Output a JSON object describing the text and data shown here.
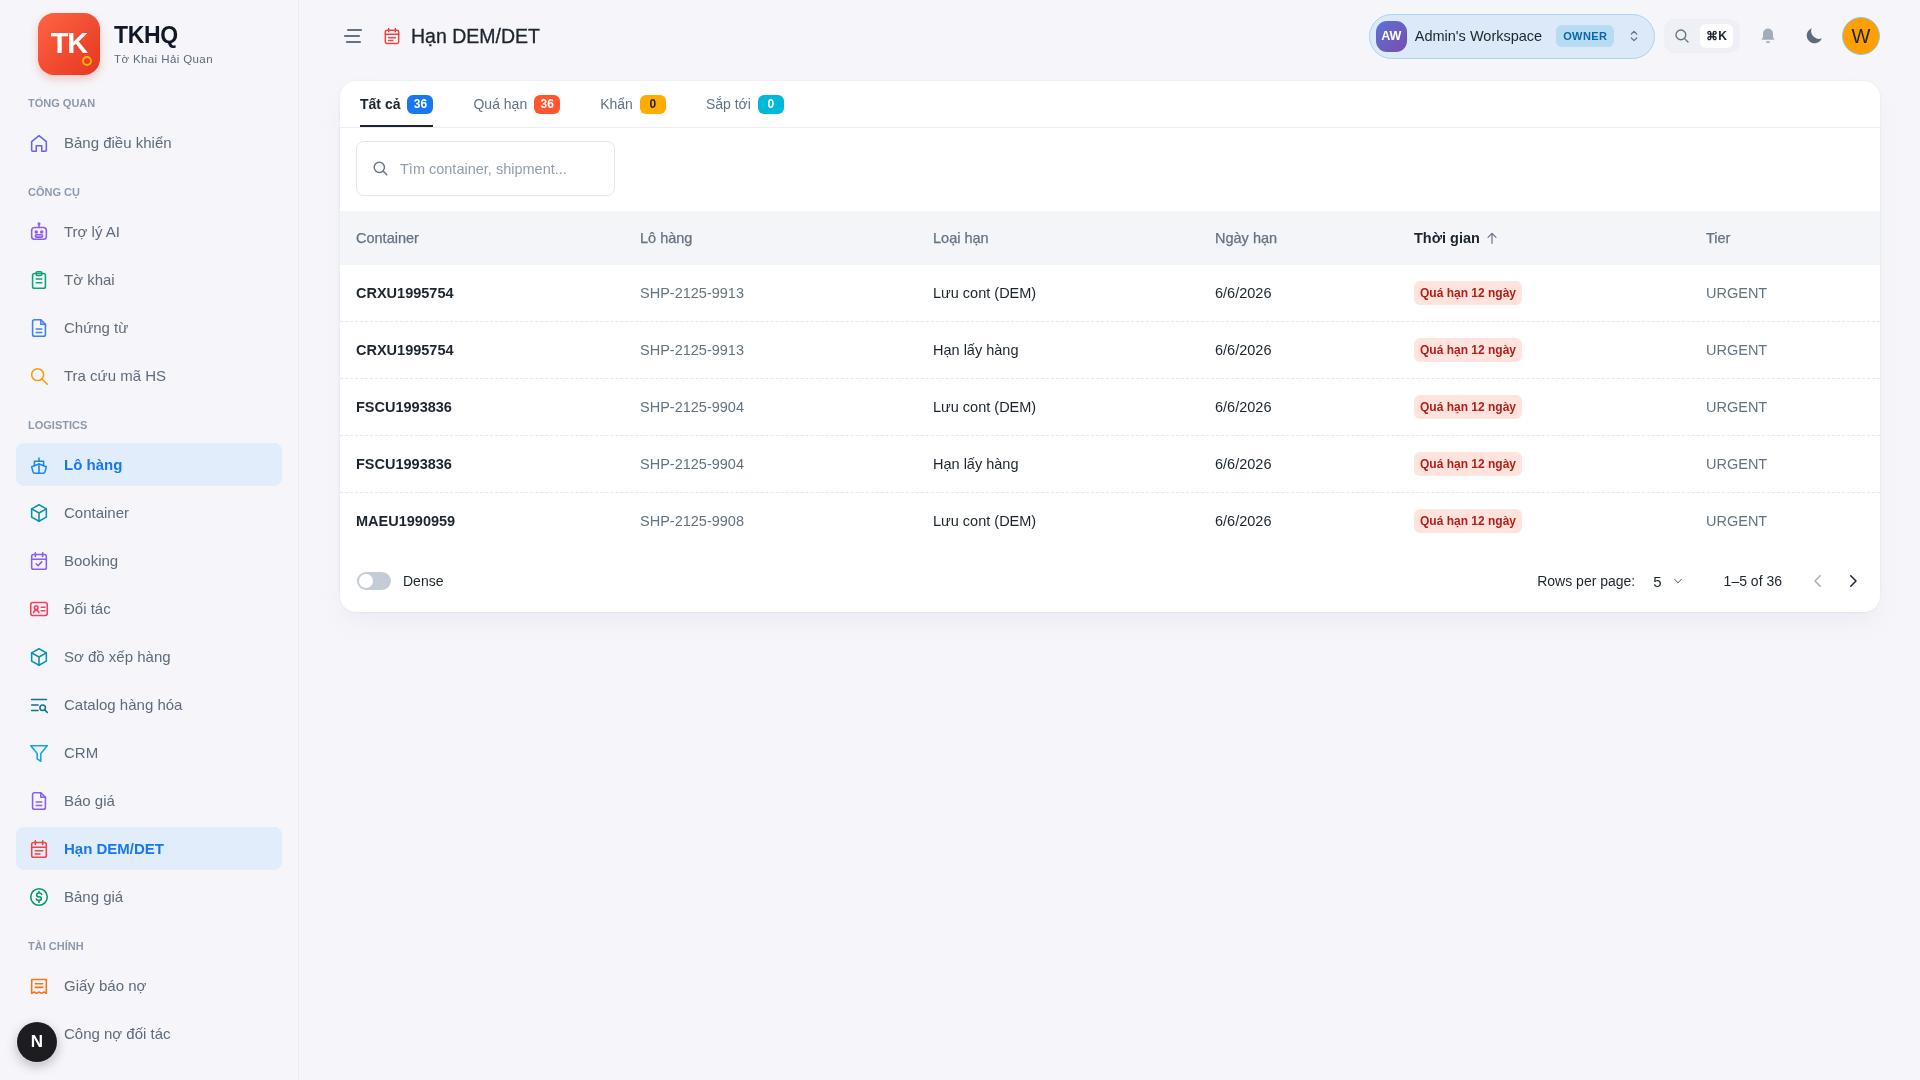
{
  "sidebar": {
    "logo": "TK",
    "app_name": "TKHQ",
    "app_subtitle": "Tờ Khai Hải Quan",
    "sections": [
      {
        "title": "TỔNG QUAN",
        "items": [
          {
            "label": "Bảng điều khiển",
            "selected": false
          }
        ]
      },
      {
        "title": "CÔNG CỤ",
        "items": [
          {
            "label": "Trợ lý AI",
            "selected": false
          },
          {
            "label": "Tờ khai",
            "selected": false
          },
          {
            "label": "Chứng từ",
            "selected": false
          },
          {
            "label": "Tra cứu mã HS",
            "selected": false
          }
        ]
      },
      {
        "title": "LOGISTICS",
        "items": [
          {
            "label": "Lô hàng",
            "selected": true
          },
          {
            "label": "Container",
            "selected": false
          },
          {
            "label": "Booking",
            "selected": false
          },
          {
            "label": "Đối tác",
            "selected": false
          },
          {
            "label": "Sơ đồ xếp hàng",
            "selected": false
          },
          {
            "label": "Catalog hàng hóa",
            "selected": false
          },
          {
            "label": "CRM",
            "selected": false
          },
          {
            "label": "Báo giá",
            "selected": false
          },
          {
            "label": "Hạn DEM/DET",
            "selected": true
          },
          {
            "label": "Bảng giá",
            "selected": false
          }
        ]
      },
      {
        "title": "TÀI CHÍNH",
        "items": [
          {
            "label": "Giấy báo nợ",
            "selected": false
          },
          {
            "label": "Công nợ đối tác",
            "selected": false
          }
        ]
      }
    ]
  },
  "dev_indicator": "N",
  "header": {
    "title": "Hạn DEM/DET",
    "workspace": {
      "initials": "AW",
      "name": "Admin's Workspace",
      "role": "OWNER"
    },
    "search_shortcut": "⌘K",
    "user_initial": "W"
  },
  "tabs": [
    {
      "label": "Tất cả",
      "count": "36",
      "color": "#1877f2",
      "selected": true
    },
    {
      "label": "Quá hạn",
      "count": "36",
      "color": "#ff5630",
      "selected": false
    },
    {
      "label": "Khẩn",
      "count": "0",
      "color": "#ffab00",
      "selected": false
    },
    {
      "label": "Sắp tới",
      "count": "0",
      "color": "#00b8d9",
      "selected": false
    }
  ],
  "search": {
    "placeholder": "Tìm container, shipment..."
  },
  "table": {
    "columns": [
      {
        "label": "Container",
        "sorted": false
      },
      {
        "label": "Lô hàng",
        "sorted": false
      },
      {
        "label": "Loại hạn",
        "sorted": false
      },
      {
        "label": "Ngày hạn",
        "sorted": false
      },
      {
        "label": "Thời gian",
        "sorted": true
      },
      {
        "label": "Tier",
        "sorted": false
      }
    ],
    "rows": [
      {
        "container": "CRXU1995754",
        "shipment": "SHP-2125-9913",
        "deadline_type": "Lưu cont (DEM)",
        "due_date": "6/6/2026",
        "time_left": "Quá hạn 12 ngày",
        "tier": "URGENT"
      },
      {
        "container": "CRXU1995754",
        "shipment": "SHP-2125-9913",
        "deadline_type": "Hạn lấy hàng",
        "due_date": "6/6/2026",
        "time_left": "Quá hạn 12 ngày",
        "tier": "URGENT"
      },
      {
        "container": "FSCU1993836",
        "shipment": "SHP-2125-9904",
        "deadline_type": "Lưu cont (DEM)",
        "due_date": "6/6/2026",
        "time_left": "Quá hạn 12 ngày",
        "tier": "URGENT"
      },
      {
        "container": "FSCU1993836",
        "shipment": "SHP-2125-9904",
        "deadline_type": "Hạn lấy hàng",
        "due_date": "6/6/2026",
        "time_left": "Quá hạn 12 ngày",
        "tier": "URGENT"
      },
      {
        "container": "MAEU1990959",
        "shipment": "SHP-2125-9908",
        "deadline_type": "Lưu cont (DEM)",
        "due_date": "6/6/2026",
        "time_left": "Quá hạn 12 ngày",
        "tier": "URGENT"
      }
    ]
  },
  "footer": {
    "dense": {
      "label": "Dense",
      "on": false
    },
    "rows_per_page_label": "Rows per page:",
    "rows_per_page": "5",
    "range": "1–5 of 36",
    "prev_page": {
      "disabled": true
    },
    "next_page": {
      "disabled": false
    }
  }
}
